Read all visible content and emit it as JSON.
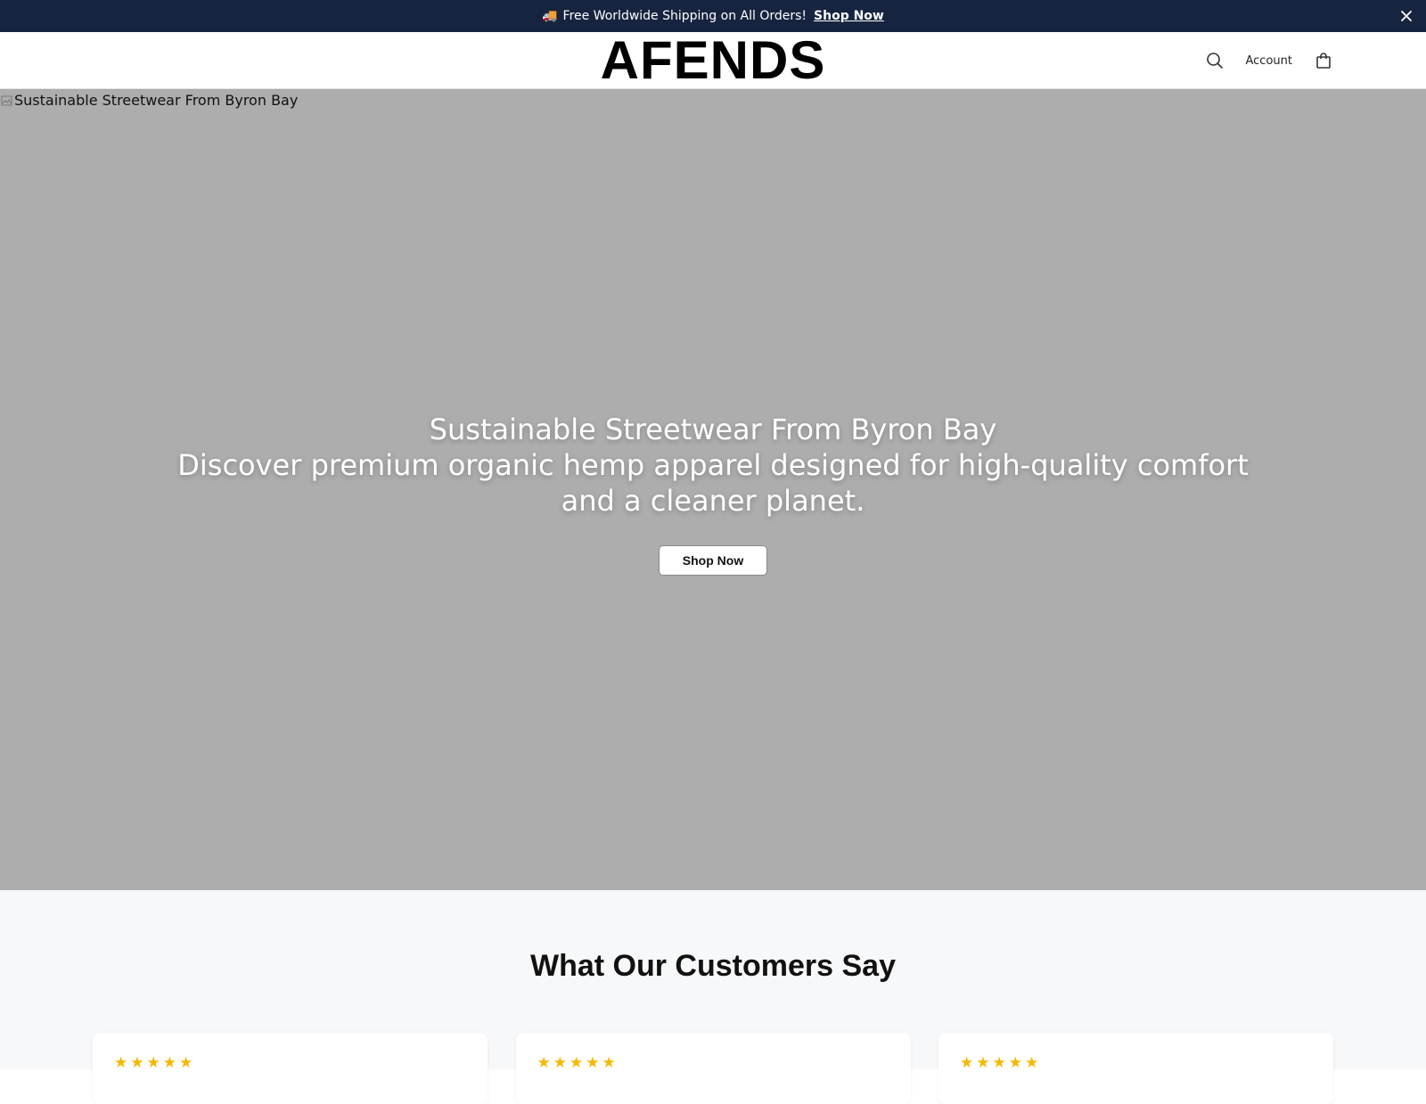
{
  "announcement": {
    "text": "Free Worldwide Shipping on All Orders!",
    "link_label": "Shop Now",
    "icon": "truck-emoji",
    "background": "#172440"
  },
  "header": {
    "logo": "AFENDS",
    "search_icon": "search-icon",
    "account_label": "Account",
    "cart_icon": "shopping-bag-icon"
  },
  "hero": {
    "image_alt": "Sustainable Streetwear From Byron Bay",
    "title": "Sustainable Streetwear From Byron Bay",
    "subtitle": "Discover premium organic hemp apparel designed for high-quality comfort and a cleaner planet.",
    "cta_label": "Shop Now",
    "background": "#adadad"
  },
  "testimonials": {
    "heading": "What Our Customers Say",
    "cards": [
      {
        "stars": "★★★★★",
        "rating": 5
      },
      {
        "stars": "★★★★★",
        "rating": 5
      },
      {
        "stars": "★★★★★",
        "rating": 5
      }
    ],
    "star_color": "#f5b800"
  }
}
